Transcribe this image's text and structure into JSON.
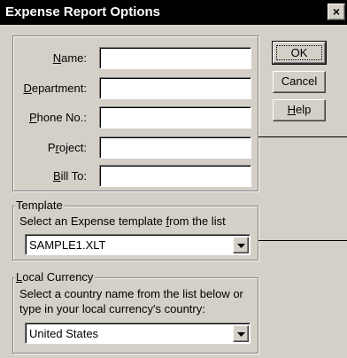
{
  "window": {
    "title": "Expense Report Options",
    "close_glyph": "×"
  },
  "info": {
    "fields": [
      {
        "pre": "",
        "key": "N",
        "post": "ame:",
        "value": ""
      },
      {
        "pre": "",
        "key": "D",
        "post": "epartment:",
        "value": ""
      },
      {
        "pre": "",
        "key": "P",
        "post": "hone No.:",
        "value": ""
      },
      {
        "pre": "P",
        "key": "r",
        "post": "oject:",
        "value": ""
      },
      {
        "pre": "",
        "key": "B",
        "post": "ill To:",
        "value": ""
      }
    ]
  },
  "buttons": {
    "ok": "OK",
    "cancel": "Cancel",
    "help_key": "H",
    "help_rest": "elp"
  },
  "template": {
    "group_title": "Template",
    "desc_pre": "Select an Expense template ",
    "desc_key": "f",
    "desc_post": "rom the list",
    "selected": "SAMPLE1.XLT"
  },
  "currency": {
    "title_key": "L",
    "title_rest": "ocal Currency",
    "desc_line1": "Select a country name from the list below or",
    "desc_line2": "type in your local currency's country:",
    "selected": "United States"
  },
  "icons": {
    "dropdown": "chevron-down-icon",
    "close": "close-icon"
  }
}
